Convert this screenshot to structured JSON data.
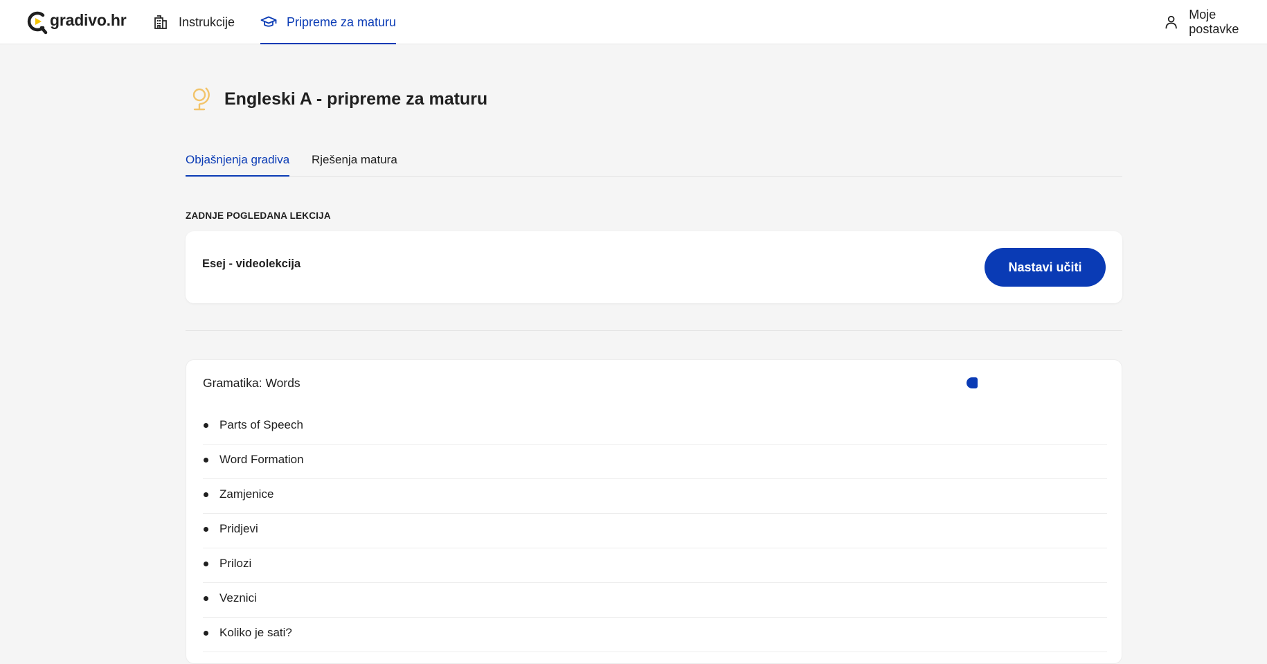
{
  "header": {
    "logo_text": "gradivo.hr",
    "nav": [
      {
        "label": "Instrukcije",
        "icon": "building-icon"
      },
      {
        "label": "Pripreme za maturu",
        "icon": "graduation-cap-icon",
        "active": true
      }
    ],
    "settings_label": "Moje postavke",
    "settings_icon": "user-icon"
  },
  "page": {
    "icon": "globe-icon",
    "title": "Engleski A - pripreme za maturu"
  },
  "tabs": [
    {
      "label": "Objašnjenja gradiva",
      "active": true
    },
    {
      "label": "Rješenja matura",
      "active": false
    }
  ],
  "last_viewed": {
    "section_label": "ZADNJE POGLEDANA LEKCIJA",
    "lesson_title": "Esej - videolekcija",
    "button_label": "Nastavi učiti"
  },
  "topic": {
    "title": "Gramatika: Words",
    "lessons": [
      "Parts of Speech",
      "Word Formation",
      "Zamjenice",
      "Pridjevi",
      "Prilozi",
      "Veznici",
      "Koliko je sati?"
    ]
  },
  "colors": {
    "accent": "#0a3bb5",
    "globe_icon": "#f2c46b",
    "background": "#f5f5f5"
  }
}
